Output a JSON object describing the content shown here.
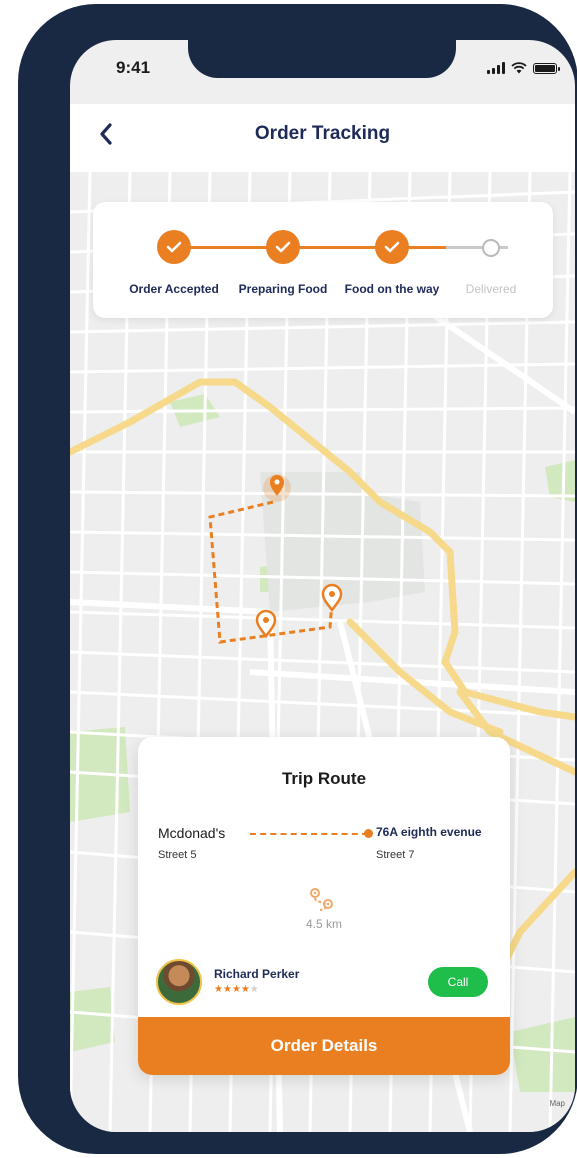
{
  "status_bar": {
    "time": "9:41"
  },
  "header": {
    "title": "Order Tracking"
  },
  "progress": {
    "steps": [
      {
        "label": "Order Accepted",
        "state": "done"
      },
      {
        "label": "Preparing Food",
        "state": "done"
      },
      {
        "label": "Food on the way",
        "state": "done"
      },
      {
        "label": "Delivered",
        "state": "pending"
      }
    ]
  },
  "trip": {
    "title": "Trip Route",
    "from_name": "Mcdonad's",
    "from_street": "Street 5",
    "to_name": "76A eighth evenue",
    "to_street": "Street 7",
    "distance": "4.5 km"
  },
  "driver": {
    "name": "Richard Perker",
    "rating": 4,
    "rating_max": 5,
    "call_label": "Call"
  },
  "order_button_label": "Order Details",
  "map_credit": "Map",
  "colors": {
    "accent": "#ea7f22",
    "navy": "#1e2a57",
    "phone_frame": "#1a2943",
    "call_green": "#1fbd4a",
    "road_major": "#f6d98a",
    "park_green": "#cfe7b8"
  }
}
